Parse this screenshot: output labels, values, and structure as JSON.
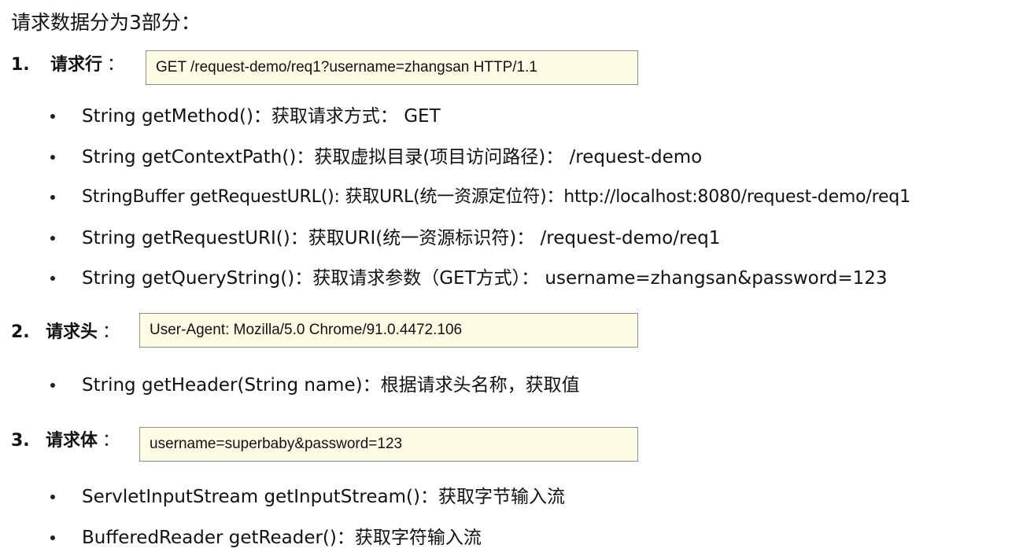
{
  "title": "请求数据分为3部分：",
  "sections": [
    {
      "number": "1.",
      "label": "请求行",
      "colon": "：",
      "box_text": "GET /request-demo/req1?username=zhangsan HTTP/1.1",
      "items": [
        "String getMethod()：获取请求方式： GET",
        "String getContextPath()：获取虚拟目录(项目访问路径)： /request-demo",
        "StringBuffer getRequestURL(): 获取URL(统一资源定位符)：http://localhost:8080/request-demo/req1",
        "String getRequestURI()：获取URI(统一资源标识符)： /request-demo/req1",
        "String getQueryString()：获取请求参数（GET方式）： username=zhangsan&password=123"
      ]
    },
    {
      "number": "2.",
      "label": "请求头",
      "colon": "：",
      "box_text": "User-Agent: Mozilla/5.0 Chrome/91.0.4472.106",
      "items": [
        "String getHeader(String name)：根据请求头名称，获取值"
      ]
    },
    {
      "number": "3.",
      "label": "请求体",
      "colon": "：",
      "box_text": "username=superbaby&password=123",
      "items": [
        "ServletInputStream  getInputStream()：获取字节输入流",
        "BufferedReader getReader()：获取字符输入流"
      ]
    }
  ]
}
